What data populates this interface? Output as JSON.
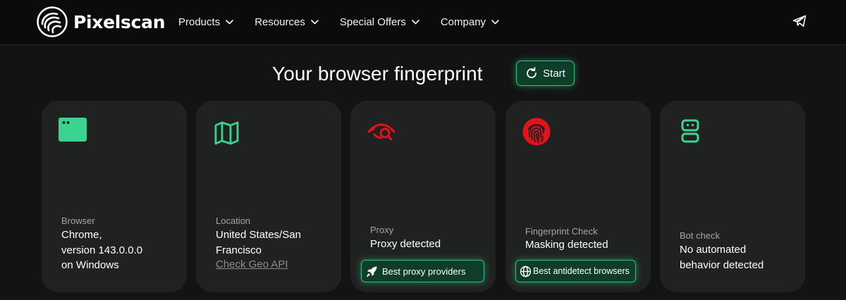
{
  "colors": {
    "accent_green": "#2ec27e",
    "alert_red": "#e3131b",
    "card_bg": "#202222",
    "page_bg": "#131313"
  },
  "header": {
    "brand": "Pixelscan",
    "logo_icon": "pixelscan-logo-icon",
    "nav": [
      {
        "label": "Products",
        "icon": "chevron-down-icon"
      },
      {
        "label": "Resources",
        "icon": "chevron-down-icon"
      },
      {
        "label": "Special Offers",
        "icon": "chevron-down-icon"
      },
      {
        "label": "Company",
        "icon": "chevron-down-icon"
      }
    ],
    "telegram_icon": "telegram-icon"
  },
  "main": {
    "title": "Your browser fingerprint",
    "start_label": "Start",
    "start_icon": "refresh-icon"
  },
  "cards": {
    "browser": {
      "icon": "browser-window-icon",
      "label": "Browser",
      "value_lines": [
        "Chrome,",
        "version 143.0.0.0",
        "on Windows"
      ]
    },
    "location": {
      "icon": "map-icon",
      "label": "Location",
      "value_lines": [
        "United States/San",
        "Francisco"
      ],
      "link": "Check Geo API"
    },
    "proxy": {
      "icon": "eye-search-icon",
      "label": "Proxy",
      "value": "Proxy detected",
      "button": "Best proxy providers",
      "button_icon": "rocket-icon"
    },
    "fingerprint": {
      "icon": "fingerprint-icon",
      "label": "Fingerprint Check",
      "value": "Masking detected",
      "button": "Best antidetect browsers",
      "button_icon": "globe-icon"
    },
    "bot": {
      "icon": "robot-icon",
      "label": "Bot check",
      "value_lines": [
        "No automated",
        "behavior detected"
      ]
    }
  }
}
